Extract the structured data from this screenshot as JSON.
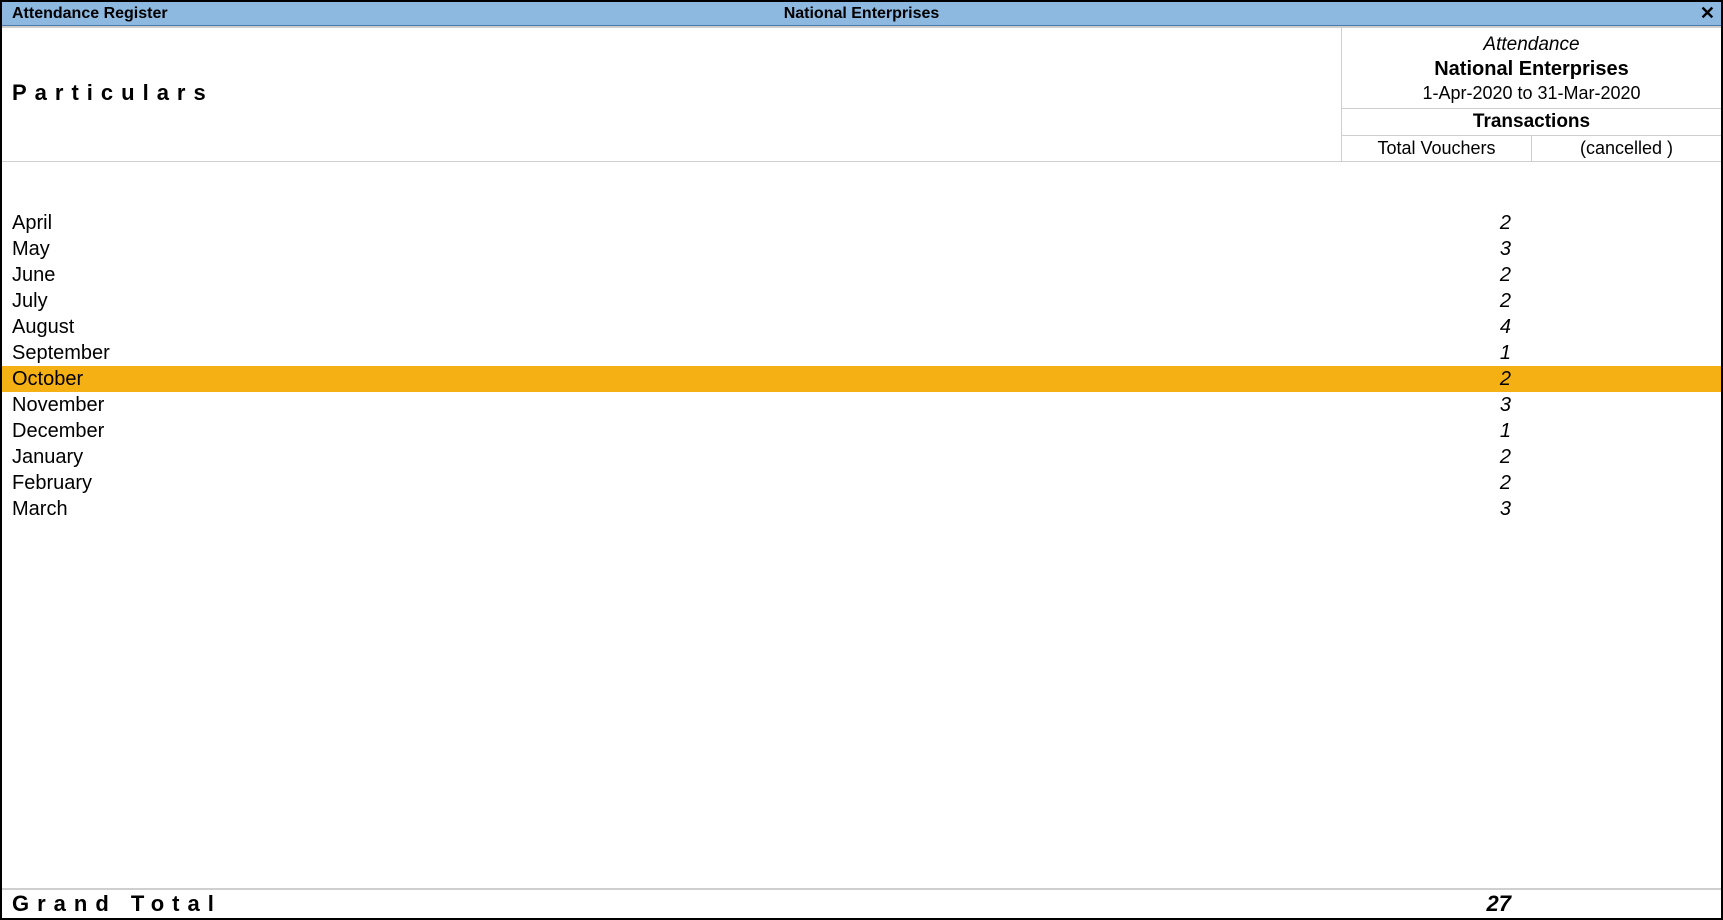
{
  "titlebar": {
    "left": "Attendance Register",
    "center": "National Enterprises",
    "close": "✕"
  },
  "header": {
    "particulars_label": "Particulars",
    "attendance_label": "Attendance",
    "company_name": "National Enterprises",
    "date_range": "1-Apr-2020 to 31-Mar-2020",
    "transactions_label": "Transactions",
    "total_vouchers_label": "Total Vouchers",
    "cancelled_label": "(cancelled )"
  },
  "rows": [
    {
      "month": "April",
      "vouchers": "2",
      "cancelled": "",
      "selected": false
    },
    {
      "month": "May",
      "vouchers": "3",
      "cancelled": "",
      "selected": false
    },
    {
      "month": "June",
      "vouchers": "2",
      "cancelled": "",
      "selected": false
    },
    {
      "month": "July",
      "vouchers": "2",
      "cancelled": "",
      "selected": false
    },
    {
      "month": "August",
      "vouchers": "4",
      "cancelled": "",
      "selected": false
    },
    {
      "month": "September",
      "vouchers": "1",
      "cancelled": "",
      "selected": false
    },
    {
      "month": "October",
      "vouchers": "2",
      "cancelled": "",
      "selected": true
    },
    {
      "month": "November",
      "vouchers": "3",
      "cancelled": "",
      "selected": false
    },
    {
      "month": "December",
      "vouchers": "1",
      "cancelled": "",
      "selected": false
    },
    {
      "month": "January",
      "vouchers": "2",
      "cancelled": "",
      "selected": false
    },
    {
      "month": "February",
      "vouchers": "2",
      "cancelled": "",
      "selected": false
    },
    {
      "month": "March",
      "vouchers": "3",
      "cancelled": "",
      "selected": false
    }
  ],
  "footer": {
    "label": "Grand Total",
    "total": "27",
    "cancelled": ""
  }
}
